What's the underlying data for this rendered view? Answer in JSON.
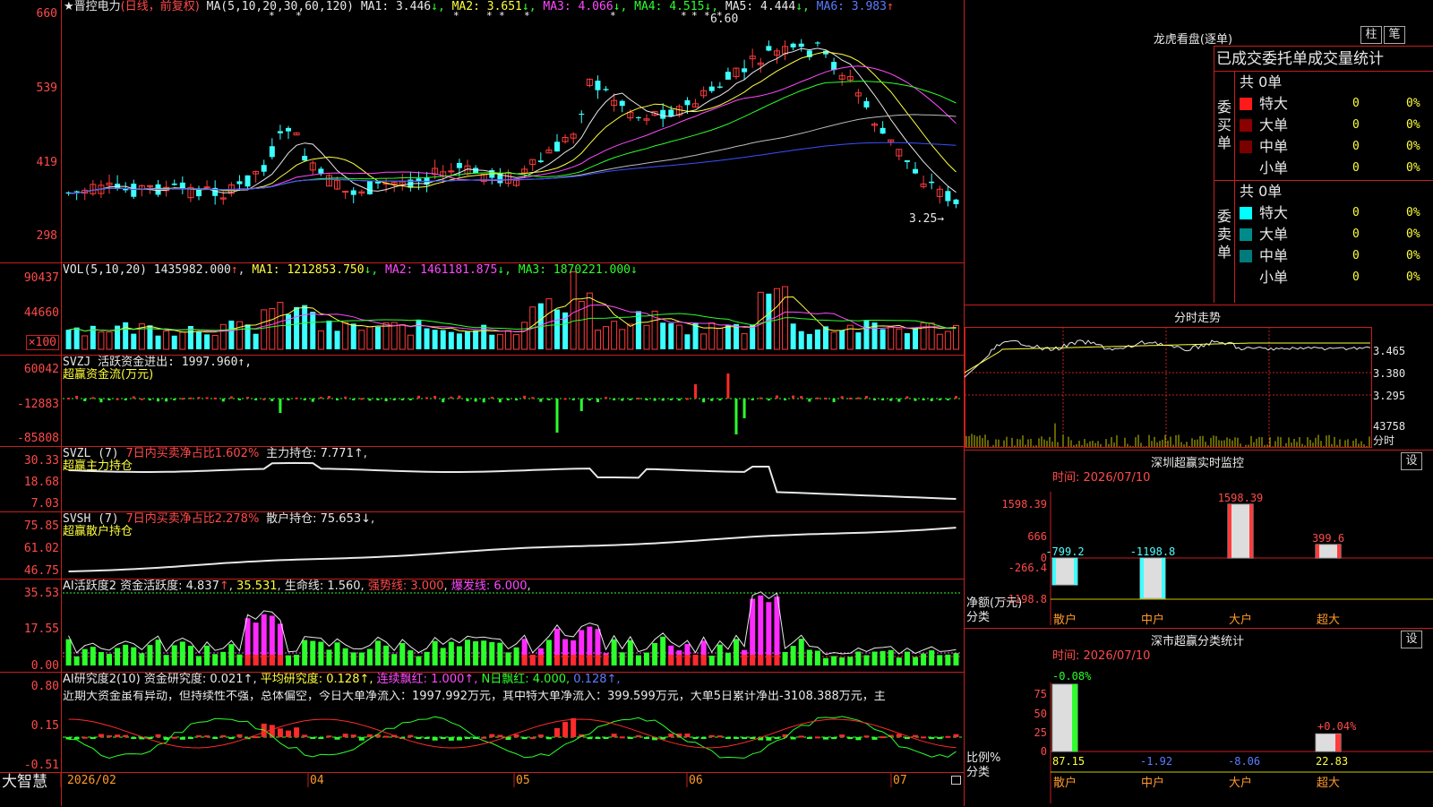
{
  "stock": {
    "name": "★晋控电力",
    "period": "(日线，前复权)"
  },
  "k_panel": {
    "y_labels": [
      "660",
      "539",
      "419",
      "298"
    ],
    "ma_label": "MA(5,10,20,30,60,120)",
    "ma": [
      {
        "name": "MA1:",
        "value": "3.446",
        "arrow": "↓",
        "color": "#e8e8e8"
      },
      {
        "name": "MA2:",
        "value": "3.651",
        "arrow": "↓",
        "color": "#ffff3c"
      },
      {
        "name": "MA3:",
        "value": "4.066",
        "arrow": "↓",
        "color": "#ff4aff"
      },
      {
        "name": "MA4:",
        "value": "4.515",
        "arrow": "↓",
        "color": "#2cff2c"
      },
      {
        "name": "MA5:",
        "value": "4.444",
        "arrow": "↓",
        "color": "#e8e8e8"
      },
      {
        "name": "MA6:",
        "value": "3.983",
        "arrow": "↑",
        "color": "#5c7cff"
      }
    ],
    "high_label": "6.60",
    "low_label": "3.25→"
  },
  "vol_panel": {
    "y_labels": [
      "90437",
      "44660",
      "×100"
    ],
    "label": "VOL(5,10,20)",
    "value": "1435982.000",
    "ma": [
      {
        "name": "MA1:",
        "value": "1212853.750",
        "arrow": "↓",
        "color": "#ffff3c"
      },
      {
        "name": "MA2:",
        "value": "1461181.875",
        "arrow": "↓",
        "color": "#ff4aff"
      },
      {
        "name": "MA3:",
        "value": "1870221.000",
        "arrow": "↓",
        "color": "#2cff2c"
      }
    ]
  },
  "svzj_panel": {
    "y_labels": [
      "60042",
      "-12883",
      "-85808"
    ],
    "line1": "SVZJ  活跃资金进出: 1997.960↑,",
    "line2": "超赢资金流(万元)"
  },
  "svzl_panel": {
    "y_labels": [
      "30.33",
      "18.68",
      "7.03"
    ],
    "prefix": "SVZL (7)",
    "desc": "7日内买卖净占比1.602%",
    "main": "主力持仓: 7.771↑,",
    "line2": "超赢主力持仓"
  },
  "svsh_panel": {
    "y_labels": [
      "75.85",
      "61.02",
      "46.75"
    ],
    "prefix": "SVSH (7)",
    "desc": "7日内买卖净占比2.278%",
    "main": "散户持仓: 75.653↓,",
    "line2": "超赢散户持仓"
  },
  "ai1_panel": {
    "y_labels": [
      "35.53",
      "17.55",
      "0.00"
    ],
    "prefix": "AI活跃度2",
    "p1": "资金活跃度: 4.837",
    "p2": "35.531",
    "p3": "生命线: 1.560",
    "p4": "强势线: 3.000",
    "p5": "爆发线: 6.000"
  },
  "ai2_panel": {
    "y_labels": [
      "0.80",
      "0.15",
      "-0.51"
    ],
    "prefix": "AI研究度2(10)",
    "p1": "资金研究度: 0.021↑,",
    "p2": "平均研究度: 0.128↑,",
    "p3": "连续飘红: 1.000↑,",
    "p4": "N日飘红: 4.000,",
    "p5": "0.128↑,",
    "comment": "近期大资金虽有异动，但持续性不强，总体偏空，今日大单净流入：1997.992万元，其中特大单净流入：399.599万元，大单5日累计净出-3108.388万元，主"
  },
  "xaxis": {
    "brand": "大智慧",
    "ticks": [
      "2026/02",
      "04",
      "05",
      "06",
      "07"
    ]
  },
  "lhkp": {
    "title": "龙虎看盘(逐单)",
    "btn1": "柱",
    "btn2": "笔",
    "subtitle": "已成交委托单成交量统计",
    "buy": {
      "side": "委买单",
      "total": "共 0单",
      "rows": [
        {
          "label": "特大",
          "count": "0",
          "pct": "0%",
          "color": "#ff1a1a"
        },
        {
          "label": "大单",
          "count": "0",
          "pct": "0%",
          "color": "#8b0000"
        },
        {
          "label": "中单",
          "count": "0",
          "pct": "0%",
          "color": "#7a0000"
        },
        {
          "label": "小单",
          "count": "0",
          "pct": "0%",
          "color": ""
        }
      ]
    },
    "sell": {
      "side": "委卖单",
      "total": "共 0单",
      "rows": [
        {
          "label": "特大",
          "count": "0",
          "pct": "0%",
          "color": "#00ffff"
        },
        {
          "label": "大单",
          "count": "0",
          "pct": "0%",
          "color": "#008b8b"
        },
        {
          "label": "中单",
          "count": "0",
          "pct": "0%",
          "color": "#007a7a"
        },
        {
          "label": "小单",
          "count": "0",
          "pct": "0%",
          "color": ""
        }
      ]
    }
  },
  "fenshi": {
    "title": "分时走势",
    "prices": [
      "3.465",
      "3.380",
      "3.295"
    ],
    "vol_label": "43758",
    "unit": "分时"
  },
  "szjk": {
    "title": "深圳超赢实时监控",
    "gear": "设",
    "time": "时间: 2026/07/10",
    "unit": "净额(万元)",
    "cat_label": "分类",
    "y_labels": [
      "1598.39",
      "666",
      "0",
      "-266.4",
      "-1198.8"
    ],
    "categories": [
      "散户",
      "中户",
      "大户",
      "超大"
    ],
    "values": [
      -799.2,
      -1198.8,
      1598.39,
      399.6
    ],
    "value_labels": [
      "-799.2",
      "-1198.8",
      "1598.39",
      "399.6"
    ]
  },
  "fltj": {
    "title": "深市超赢分类统计",
    "gear": "设",
    "time": "时间: 2026/07/10",
    "unit": "比例%",
    "cat_label": "分类",
    "y_labels": [
      "75",
      "50",
      "25",
      "0"
    ],
    "top_labels": [
      "-0.08%",
      "+0.04%"
    ],
    "categories": [
      "散户",
      "中户",
      "大户",
      "超大"
    ],
    "values": [
      87.15,
      -1.92,
      -8.06,
      22.83
    ],
    "value_labels": [
      "87.15",
      "-1.92",
      "-8.06",
      "22.83"
    ]
  }
}
